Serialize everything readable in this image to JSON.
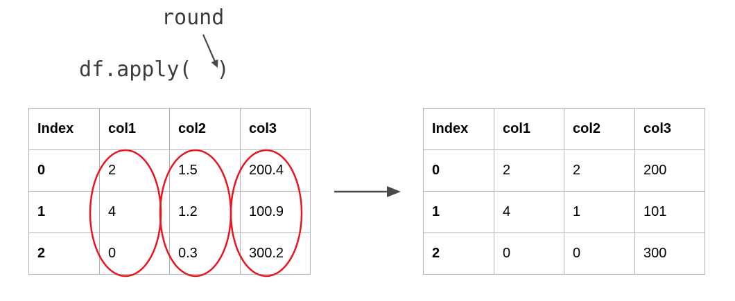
{
  "code": {
    "function_name": "round",
    "expression": "df.apply(  )"
  },
  "input_table": {
    "headers": [
      "Index",
      "col1",
      "col2",
      "col3"
    ],
    "rows": [
      [
        "0",
        "2",
        "1.5",
        "200.4"
      ],
      [
        "1",
        "4",
        "1.2",
        "100.9"
      ],
      [
        "2",
        "0",
        "0.3",
        "300.2"
      ]
    ]
  },
  "output_table": {
    "headers": [
      "Index",
      "col1",
      "col2",
      "col3"
    ],
    "rows": [
      [
        "0",
        "2",
        "2",
        "200"
      ],
      [
        "1",
        "4",
        "1",
        "101"
      ],
      [
        "2",
        "0",
        "0",
        "300"
      ]
    ]
  },
  "colors": {
    "highlight": "#e8141e",
    "arrow": "#4a4a4a",
    "grid": "#b4b4b4",
    "code_text": "#3d3d3d"
  },
  "icons": [
    "function-pointer-arrow-icon",
    "transform-arrow-icon"
  ]
}
